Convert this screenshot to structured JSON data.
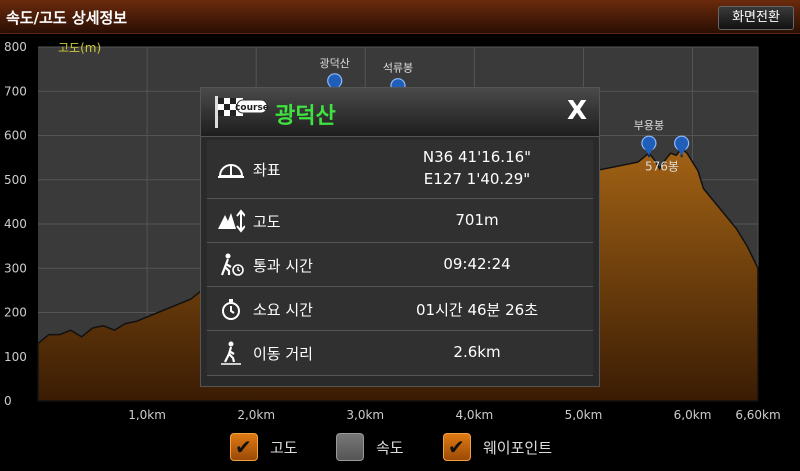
{
  "header": {
    "title": "속도/고도 상세정보",
    "switch_label": "화면전환"
  },
  "colors": {
    "fill_top": "#b97218",
    "fill_bottom": "#3a1c04",
    "accent_green": "#3fe23f",
    "checkbox_on": "#e07a14"
  },
  "chart_data": {
    "type": "area",
    "title": "",
    "ylabel": "고도(m)",
    "xlabel": "",
    "xlim": [
      0,
      6.6
    ],
    "ylim": [
      0,
      800
    ],
    "yticks": [
      "0",
      "100",
      "200",
      "300",
      "400",
      "500",
      "600",
      "700",
      "800"
    ],
    "xtick_labels": [
      "1,0km",
      "2,0km",
      "3,0km",
      "4,0km",
      "5,0km",
      "6,0km",
      "6,60km"
    ],
    "xtick_values": [
      1.0,
      2.0,
      3.0,
      4.0,
      5.0,
      6.0,
      6.6
    ],
    "series": [
      {
        "x": [
          0,
          0.1,
          0.2,
          0.3,
          0.4,
          0.5,
          0.6,
          0.7,
          0.8,
          0.9,
          1.0,
          1.1,
          1.2,
          1.3,
          1.4,
          1.5,
          1.6,
          1.7,
          1.8,
          1.9,
          2.0,
          2.1,
          2.2,
          2.3,
          2.4,
          2.5,
          2.6,
          2.7,
          2.8,
          2.9,
          3.0,
          5.1,
          5.2,
          5.3,
          5.4,
          5.5,
          5.55,
          5.6,
          5.65,
          5.7,
          5.75,
          5.8,
          5.85,
          5.9,
          5.95,
          6.0,
          6.05,
          6.1,
          6.2,
          6.3,
          6.4,
          6.5,
          6.6
        ],
        "y": [
          130,
          150,
          150,
          160,
          145,
          165,
          170,
          160,
          175,
          180,
          190,
          200,
          210,
          220,
          230,
          250,
          300,
          340,
          360,
          400,
          430,
          480,
          520,
          560,
          590,
          630,
          660,
          690,
          700,
          670,
          640,
          520,
          525,
          530,
          535,
          540,
          550,
          560,
          545,
          525,
          545,
          560,
          555,
          570,
          560,
          540,
          520,
          480,
          450,
          420,
          390,
          350,
          300
        ]
      }
    ],
    "waypoints": [
      {
        "name": "광덕산",
        "x": 2.72,
        "y": 701
      },
      {
        "name": "석류봉",
        "x": 3.3,
        "y": 690
      },
      {
        "name": "부용봉",
        "x": 5.6,
        "y": 560
      },
      {
        "name": "",
        "x": 5.9,
        "y": 560
      }
    ],
    "annotation": "576봉"
  },
  "popup": {
    "badge": "course",
    "name": "광덕산",
    "close_label": "X",
    "rows": [
      {
        "label": "좌표",
        "value": "N36 41'16.16\"",
        "value2": "E127 1'40.29\""
      },
      {
        "label": "고도",
        "value": "701m"
      },
      {
        "label": "통과 시간",
        "value": "09:42:24"
      },
      {
        "label": "소요 시간",
        "value": "01시간 46분 26초"
      },
      {
        "label": "이동 거리",
        "value": "2.6km"
      }
    ]
  },
  "legend": [
    {
      "label": "고도",
      "checked": true
    },
    {
      "label": "속도",
      "checked": false
    },
    {
      "label": "웨이포인트",
      "checked": true
    }
  ]
}
